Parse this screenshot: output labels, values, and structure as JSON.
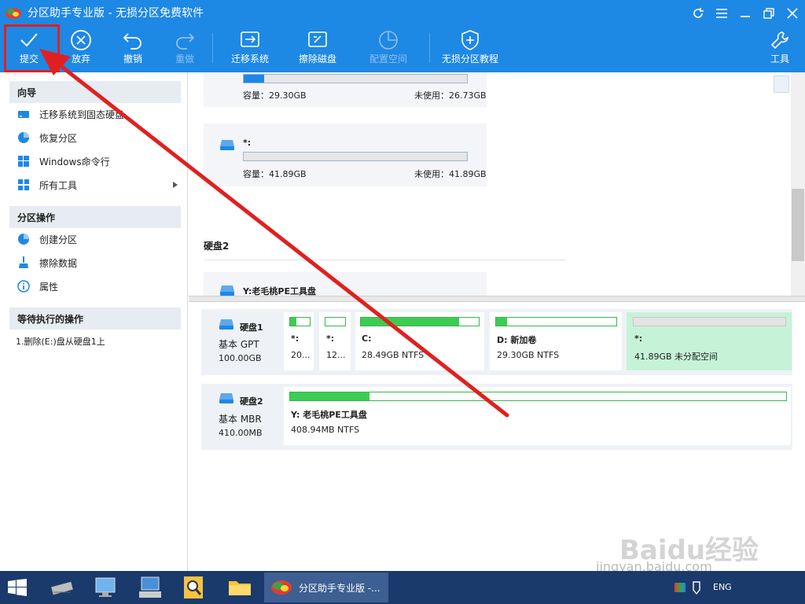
{
  "window": {
    "title": "分区助手专业版 - 无损分区免费软件"
  },
  "toolbar": {
    "commit": "提交",
    "discard": "放弃",
    "undo": "撤销",
    "redo": "重做",
    "migrate": "迁移系统",
    "wipe": "擦除磁盘",
    "allocate": "配置空间",
    "tutorial": "无损分区教程",
    "tools": "工具"
  },
  "sidebar": {
    "wizard_title": "向导",
    "wizard_items": [
      "迁移系统到固态硬盘",
      "恢复分区",
      "Windows命令行",
      "所有工具"
    ],
    "partition_ops_title": "分区操作",
    "partition_ops_items": [
      "创建分区",
      "擦除数据",
      "属性"
    ],
    "pending_title": "等待执行的操作",
    "pending_items": [
      "1.删除(E:)盘从硬盘1上"
    ]
  },
  "upper_list": {
    "card1": {
      "capacity": "容量：29.30GB",
      "unused": "未使用：26.73GB",
      "used_fraction": 0.09
    },
    "card2": {
      "name": "*:",
      "capacity": "容量：41.89GB",
      "unused": "未使用：41.89GB",
      "used_fraction": 0
    },
    "disk2_header": "硬盘2",
    "card3": {
      "name": "Y:老毛桃PE工具盘"
    }
  },
  "disk_map": {
    "disk1": {
      "name": "硬盘1",
      "type": "基本 GPT",
      "size": "100.00GB",
      "partitions": [
        {
          "name": "*:",
          "desc": "20...",
          "used_fraction": 0.3
        },
        {
          "name": "*:",
          "desc": "12...",
          "used_fraction": 0
        },
        {
          "name": "C:",
          "desc": "28.49GB NTFS",
          "used_fraction": 0.83
        },
        {
          "name": "D: 新加卷",
          "desc": "29.30GB NTFS",
          "used_fraction": 0.09
        },
        {
          "name": "*:",
          "desc": "41.89GB 未分配空间",
          "used_fraction": 0
        }
      ]
    },
    "disk2": {
      "name": "硬盘2",
      "type": "基本 MBR",
      "size": "410.00MB",
      "partitions": [
        {
          "name": "Y: 老毛桃PE工具盘",
          "desc": "408.94MB NTFS",
          "used_fraction": 0.16
        }
      ]
    }
  },
  "taskbar": {
    "active_app": "分区助手专业版 -...",
    "lang": "ENG"
  },
  "watermark": {
    "text": "Baidu经验",
    "url_text": "jingyan.baidu.com"
  },
  "colors": {
    "accent": "#1e88e5",
    "used": "#3dcc53",
    "unallocated_bg": "#c6f3d8",
    "annotation": "#e02020"
  }
}
